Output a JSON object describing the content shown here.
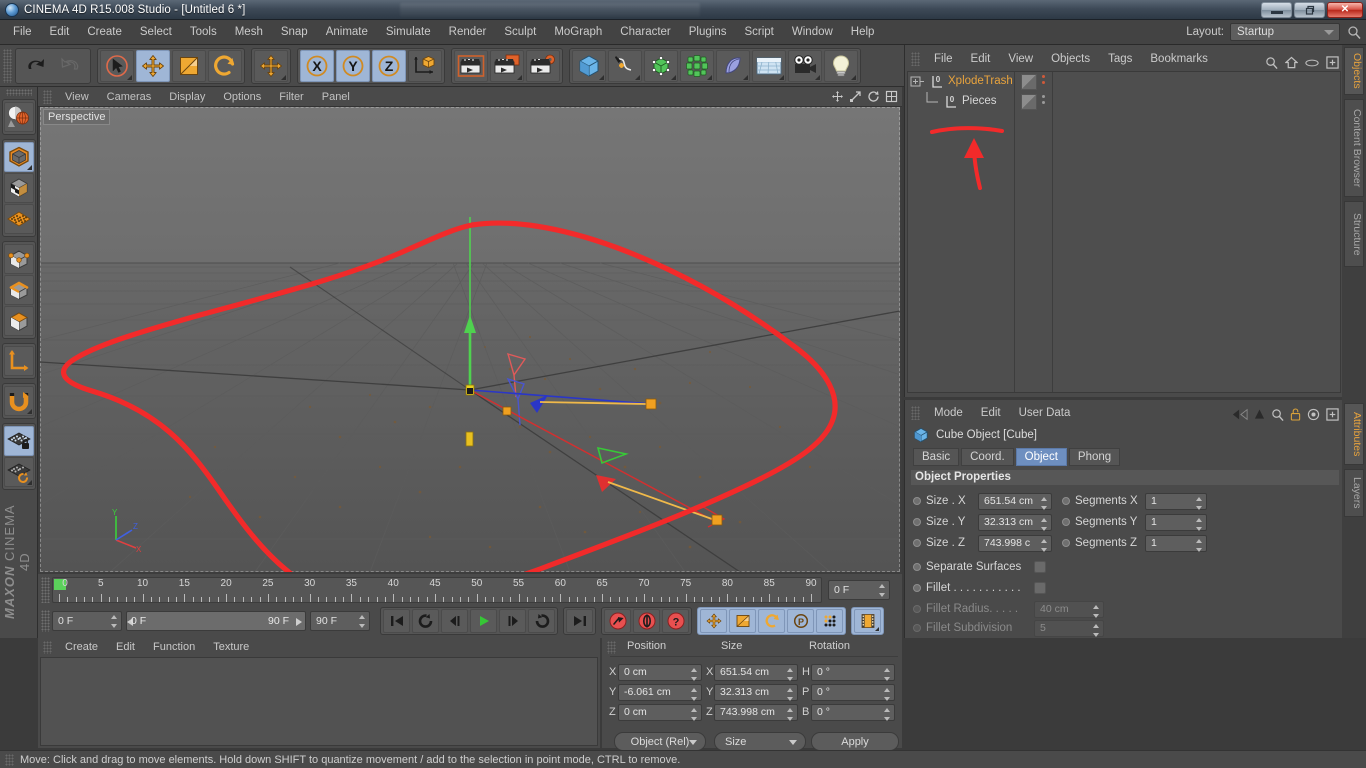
{
  "window": {
    "title": "CINEMA 4D R15.008 Studio - [Untitled 6 *]",
    "app_icon": "c4d-logo-icon",
    "minimize_label": "",
    "restore_label": "❐",
    "close_label": "✕"
  },
  "menubar": {
    "items": [
      "File",
      "Edit",
      "Create",
      "Select",
      "Tools",
      "Mesh",
      "Snap",
      "Animate",
      "Simulate",
      "Render",
      "Sculpt",
      "MoGraph",
      "Character",
      "Plugins",
      "Script",
      "Window",
      "Help"
    ],
    "layout_label": "Layout:",
    "layout_value": "Startup",
    "search_icon": "magnifier-icon"
  },
  "toolbar": {
    "groups": [
      {
        "name": "undo-redo",
        "buttons": [
          {
            "icon": "undo-icon",
            "label": "Undo",
            "selected": false,
            "corner": false
          },
          {
            "icon": "redo-icon",
            "label": "Redo",
            "selected": false,
            "corner": false,
            "disabled": true
          }
        ]
      },
      {
        "name": "transform-tools",
        "buttons": [
          {
            "icon": "live-selection-icon",
            "label": "Live Selection",
            "selected": false,
            "corner": true
          },
          {
            "icon": "move-icon",
            "label": "Move",
            "selected": true,
            "corner": false
          },
          {
            "icon": "scale-icon",
            "label": "Scale",
            "selected": false,
            "corner": false
          },
          {
            "icon": "rotate-icon",
            "label": "Rotate",
            "selected": false,
            "corner": false
          }
        ]
      },
      {
        "name": "world-object-axis",
        "buttons": [
          {
            "icon": "move-axis-icon",
            "label": "Move Axis",
            "selected": false,
            "corner": true
          }
        ]
      },
      {
        "name": "axis-locks",
        "buttons": [
          {
            "icon": "axis-x-icon",
            "label": "X",
            "selected": true,
            "corner": false
          },
          {
            "icon": "axis-y-icon",
            "label": "Y",
            "selected": true,
            "corner": false
          },
          {
            "icon": "axis-z-icon",
            "label": "Z",
            "selected": true,
            "corner": false
          },
          {
            "icon": "world-coordinate-icon",
            "label": "World/Object",
            "selected": false,
            "corner": false
          }
        ]
      },
      {
        "name": "render-tools",
        "buttons": [
          {
            "icon": "render-view-icon",
            "label": "Render View",
            "selected": false,
            "corner": false
          },
          {
            "icon": "render-region-icon",
            "label": "Render to Picture Viewer",
            "selected": false,
            "corner": true
          },
          {
            "icon": "render-settings-icon",
            "label": "Edit Render Settings",
            "selected": false,
            "corner": false
          }
        ]
      },
      {
        "name": "create-objects",
        "buttons": [
          {
            "icon": "cube-primitive-icon",
            "label": "Add Cube Object",
            "selected": false,
            "corner": true
          },
          {
            "icon": "spline-pen-icon",
            "label": "Add Spline",
            "selected": false,
            "corner": true
          },
          {
            "icon": "nurbs-icon",
            "label": "Add HyperNURBS",
            "selected": false,
            "corner": true
          },
          {
            "icon": "array-icon",
            "label": "Add Array Object",
            "selected": false,
            "corner": true
          },
          {
            "icon": "bend-deformer-icon",
            "label": "Add Bend Object",
            "selected": false,
            "corner": true
          },
          {
            "icon": "floor-environment-icon",
            "label": "Add Floor Object",
            "selected": false,
            "corner": true
          },
          {
            "icon": "camera-icon",
            "label": "Add Camera",
            "selected": false,
            "corner": true
          },
          {
            "icon": "light-icon",
            "label": "Add Light",
            "selected": false,
            "corner": true
          }
        ]
      }
    ]
  },
  "left_toolbar": {
    "groups": [
      {
        "name": "render-preview",
        "buttons": [
          {
            "icon": "render-preview-sphere-icon",
            "label": "Interactive Render Region",
            "selected": false,
            "corner": false
          }
        ]
      },
      {
        "name": "editable-mode",
        "buttons": [
          {
            "icon": "make-editable-icon",
            "label": "Make Editable",
            "selected": true,
            "corner": true
          },
          {
            "icon": "model-mode-icon",
            "label": "Model Mode",
            "selected": false,
            "corner": false
          },
          {
            "icon": "texture-mode-icon",
            "label": "Texture Mode",
            "selected": false,
            "corner": false
          }
        ]
      },
      {
        "name": "component-mode",
        "buttons": [
          {
            "icon": "point-mode-icon",
            "label": "Points",
            "selected": false,
            "corner": false
          },
          {
            "icon": "edge-mode-icon",
            "label": "Edges",
            "selected": false,
            "corner": false
          },
          {
            "icon": "polygon-mode-icon",
            "label": "Polygons",
            "selected": false,
            "corner": false
          }
        ]
      },
      {
        "name": "axis-mode",
        "buttons": [
          {
            "icon": "enable-axis-modification-icon",
            "label": "Enable Axis Modification",
            "selected": false,
            "corner": false
          }
        ]
      },
      {
        "name": "snap-mode",
        "buttons": [
          {
            "icon": "magnet-icon",
            "label": "Enable Snapping",
            "selected": false,
            "corner": true
          }
        ]
      },
      {
        "name": "workplane",
        "buttons": [
          {
            "icon": "workplane-lock-icon",
            "label": "Lock Workplane",
            "selected": true,
            "corner": false
          },
          {
            "icon": "workplane-rotate-icon",
            "label": "Planar Workplane Modes",
            "selected": false,
            "corner": true
          }
        ]
      }
    ],
    "brand_line1": "MAXON",
    "brand_line2": "CINEMA 4D"
  },
  "viewport": {
    "menu_items": [
      "View",
      "Cameras",
      "Display",
      "Options",
      "Filter",
      "Panel"
    ],
    "label": "Perspective",
    "corner_icons": [
      "move-camera-icon",
      "scale-camera-icon",
      "rotate-camera-icon",
      "maximize-viewport-icon"
    ],
    "axis_hud": {
      "x": "X",
      "y": "Y",
      "z": "Z"
    },
    "annotation": "red-hand-drawn-loop"
  },
  "timeline": {
    "start_frame_label": "0",
    "ruler_ticks": [
      0,
      5,
      10,
      15,
      20,
      25,
      30,
      35,
      40,
      45,
      50,
      55,
      60,
      65,
      70,
      75,
      80,
      85,
      90
    ],
    "current_frame_field": "0 F",
    "frame_field": "0 F",
    "range_start": "0 F",
    "range_end": "90 F",
    "end_frame_field": "90 F",
    "transport_buttons": [
      {
        "icon": "go-to-start-icon",
        "label": "Go To Start"
      },
      {
        "icon": "play-back-loop-icon",
        "label": "Play Backwards"
      },
      {
        "icon": "previous-frame-icon",
        "label": "Go To Previous Frame"
      },
      {
        "icon": "play-forward-icon",
        "label": "Play Forwards"
      },
      {
        "icon": "next-frame-icon",
        "label": "Go To Next Frame"
      },
      {
        "icon": "play-loop-icon",
        "label": "Loop Playback"
      },
      {
        "icon": "go-to-end-icon",
        "label": "Go To End"
      }
    ],
    "record_buttons": [
      {
        "icon": "record-key-icon",
        "label": "Record Active Objects"
      },
      {
        "icon": "autokeying-icon",
        "label": "Autokeying"
      },
      {
        "icon": "keyframe-selection-icon",
        "label": "Keyframe Selection"
      }
    ],
    "param_buttons": [
      {
        "icon": "position-key-icon",
        "label": "Position",
        "selected": true
      },
      {
        "icon": "scale-key-icon",
        "label": "Scale",
        "selected": true
      },
      {
        "icon": "rotation-key-icon",
        "label": "Rotation",
        "selected": true
      },
      {
        "icon": "pla-key-icon",
        "label": "PLA",
        "selected": true
      },
      {
        "icon": "point-level-anim-icon",
        "label": "Parameter",
        "selected": true
      }
    ],
    "extra_buttons": [
      {
        "icon": "animation-filmstrip-icon",
        "label": "Animation Mode",
        "selected": true
      }
    ]
  },
  "material_manager": {
    "menu_items": [
      "Create",
      "Edit",
      "Function",
      "Texture"
    ],
    "materials": []
  },
  "coordinate_manager": {
    "headers": [
      "Position",
      "Size",
      "Rotation"
    ],
    "rows": [
      {
        "axis1": "X",
        "val1": "0 cm",
        "axis2": "X",
        "val2": "651.54 cm",
        "axis3": "H",
        "val3": "0 °"
      },
      {
        "axis1": "Y",
        "val1": "-6.061 cm",
        "axis2": "Y",
        "val2": "32.313 cm",
        "axis3": "P",
        "val3": "0 °"
      },
      {
        "axis1": "Z",
        "val1": "0 cm",
        "axis2": "Z",
        "val2": "743.998 cm",
        "axis3": "B",
        "val3": "0 °"
      }
    ],
    "mode_dropdown": "Object (Rel)",
    "size_dropdown": "Size",
    "apply_button": "Apply"
  },
  "object_manager": {
    "menu_items": [
      "File",
      "Edit",
      "View",
      "Objects",
      "Tags",
      "Bookmarks"
    ],
    "header_icons": [
      "search-icon",
      "home-icon",
      "eye-icon",
      "new-tab-icon"
    ],
    "objects": [
      {
        "name": "XplodeTrash",
        "indent": 0,
        "expandable": true,
        "highlighted": true,
        "level_badge": "0"
      },
      {
        "name": "Pieces",
        "indent": 1,
        "expandable": false,
        "highlighted": false,
        "level_badge": "0"
      }
    ]
  },
  "attribute_manager": {
    "menu_items": [
      "Mode",
      "Edit",
      "User Data"
    ],
    "header_icons": [
      "back-arrow-icon",
      "forward-arrow-icon",
      "up-arrow-icon",
      "search-icon",
      "lock-icon",
      "target-icon",
      "new-tab-icon"
    ],
    "object_title": "Cube Object [Cube]",
    "object_icon": "cube-icon",
    "tabs": [
      {
        "label": "Basic",
        "active": false
      },
      {
        "label": "Coord.",
        "active": false
      },
      {
        "label": "Object",
        "active": true
      },
      {
        "label": "Phong",
        "active": false
      }
    ],
    "section_title": "Object Properties",
    "properties": [
      {
        "label": "Size . X",
        "value": "651.54 cm",
        "label2": "Segments X",
        "value2": "1",
        "disabled": false
      },
      {
        "label": "Size . Y",
        "value": "32.313 cm",
        "label2": "Segments Y",
        "value2": "1",
        "disabled": false
      },
      {
        "label": "Size . Z",
        "value": "743.998 c",
        "label2": "Segments Z",
        "value2": "1",
        "disabled": false
      }
    ],
    "checkboxes": [
      {
        "label": "Separate Surfaces",
        "checked": false,
        "disabled": false
      },
      {
        "label": "Fillet . . . . . . . . . . .",
        "checked": false,
        "disabled": false
      }
    ],
    "dim_fields": [
      {
        "label": "Fillet Radius. . . . .",
        "value": "40 cm"
      },
      {
        "label": "Fillet Subdivision",
        "value": "5"
      }
    ]
  },
  "right_tabs": {
    "upper": [
      {
        "label": "Objects",
        "active": true
      },
      {
        "label": "Content Browser",
        "active": false
      },
      {
        "label": "Structure",
        "active": false
      }
    ],
    "lower": [
      {
        "label": "Attributes",
        "active": true
      },
      {
        "label": "Layers",
        "active": false
      }
    ]
  },
  "statusbar": {
    "text": "Move: Click and drag to move elements. Hold down SHIFT to quantize movement / add to the selection in point mode, CTRL to remove."
  },
  "colors": {
    "accent_orange": "#e8a33d",
    "selection_blue": "#9fb6d6",
    "annotation_red": "#f03030",
    "panel_bg": "#4a4a4a",
    "viewport_bg": "#6a6a6a"
  }
}
